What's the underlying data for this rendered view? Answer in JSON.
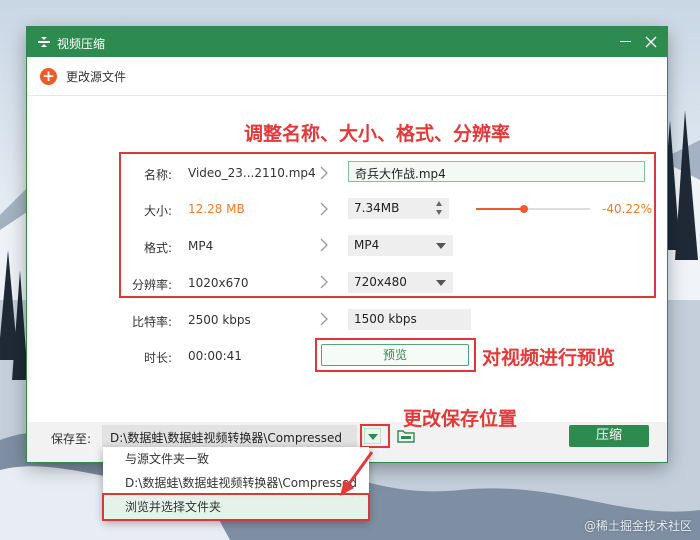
{
  "window": {
    "title": "视频压缩",
    "change_source_label": "更改源文件"
  },
  "annotations": {
    "heading": "调整名称、大小、格式、分辨率",
    "preview_note": "对视频进行预览",
    "save_note": "更改保存位置"
  },
  "rows": {
    "name": {
      "label": "名称:",
      "source": "Video_23...2110.mp4",
      "target": "奇兵大作战.mp4"
    },
    "size": {
      "label": "大小:",
      "source": "12.28 MB",
      "target": "7.34MB",
      "percent": "-40.22%",
      "slider_fraction": 0.42
    },
    "format": {
      "label": "格式:",
      "source": "MP4",
      "target": "MP4"
    },
    "resolution": {
      "label": "分辨率:",
      "source": "1020x670",
      "target": "720x480"
    },
    "bitrate": {
      "label": "比特率:",
      "source": "2500 kbps",
      "target": "1500 kbps"
    },
    "duration": {
      "label": "时长:",
      "source": "00:00:41"
    }
  },
  "preview_button": "预览",
  "save": {
    "label": "保存至:",
    "path": "D:\\数据蛙\\数据蛙视频转换器\\Compressed",
    "compress_button": "压缩"
  },
  "dropdown_options": [
    "与源文件夹一致",
    "D:\\数据蛙\\数据蛙视频转换器\\Compressed",
    "浏览并选择文件夹"
  ],
  "watermark": "@稀土掘金技术社区",
  "colors": {
    "brand_green": "#2e8b50",
    "accent_orange": "#f05a28",
    "annotation_red": "#e03a3a"
  }
}
